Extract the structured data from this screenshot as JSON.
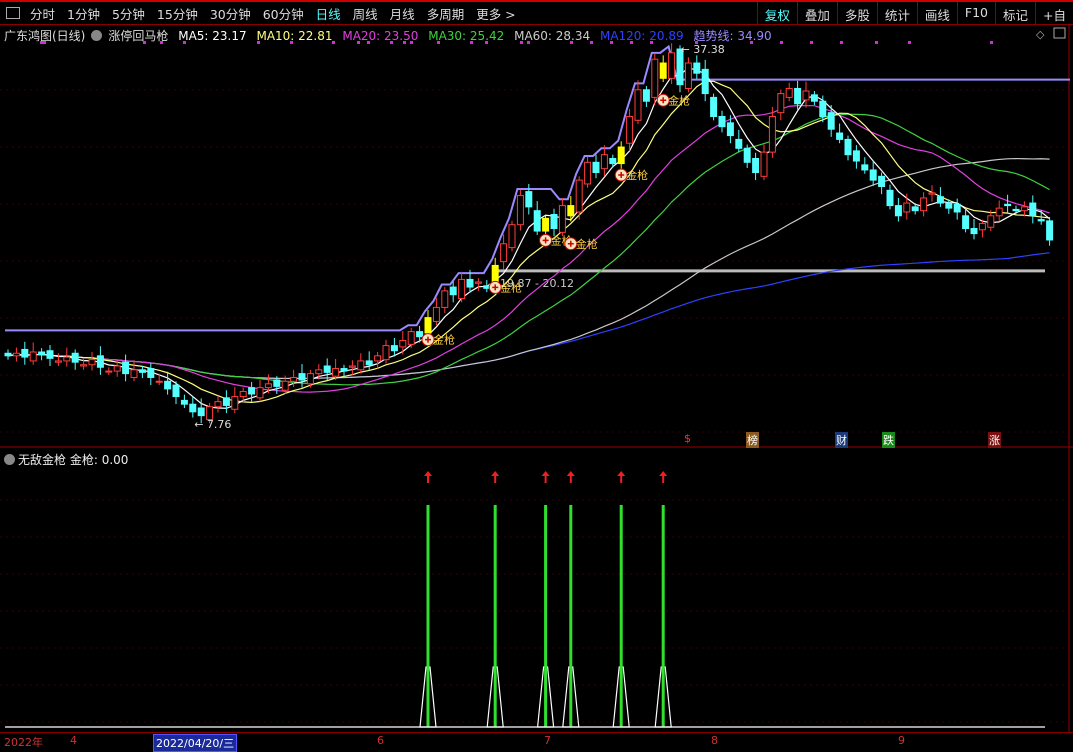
{
  "toolbar": {
    "periods": [
      "分时",
      "1分钟",
      "5分钟",
      "15分钟",
      "30分钟",
      "60分钟",
      "日线",
      "周线",
      "月线",
      "多周期",
      "更多 >"
    ],
    "active": "日线",
    "right_buttons": [
      "复权",
      "叠加",
      "多股",
      "统计",
      "画线",
      "F10",
      "标记",
      "+自"
    ]
  },
  "info": {
    "title": "广东鸿图(日线)",
    "indicator": "涨停回马枪",
    "ma5": "MA5: 23.17",
    "ma10": "MA10: 22.81",
    "ma20": "MA20: 23.50",
    "ma30": "MA30: 25.42",
    "ma60": "MA60: 28.34",
    "ma120": "MA120: 20.89",
    "trend": "趋势线: 34.90"
  },
  "colors": {
    "up": "#ff3b3b",
    "down": "#54ffff",
    "signal": "#ffff00",
    "ma5": "#ffffff",
    "ma10": "#ffff80",
    "ma20": "#e040e0",
    "ma30": "#40d040",
    "ma60": "#c8c8c8",
    "ma120": "#3040ff",
    "trend": "#9a8aff"
  },
  "annotations": {
    "high": "37.38",
    "low": "7.76",
    "range": "19.87 - 20.12",
    "signal_label": "金枪"
  },
  "events": [
    {
      "label": "$",
      "color": "#ff3030",
      "bg": "#000"
    },
    {
      "label": "榜",
      "color": "#fff",
      "bg": "#8a5a20"
    },
    {
      "label": "财",
      "color": "#fff",
      "bg": "#1a3a7a"
    },
    {
      "label": "跌",
      "color": "#fff",
      "bg": "#1a8a1a"
    },
    {
      "label": "涨",
      "color": "#fff",
      "bg": "#7a1010"
    }
  ],
  "indicator": {
    "name": "无敌金枪",
    "value": "金枪: 0.00"
  },
  "axis": {
    "labels": [
      "2022年",
      "4",
      "2022/04/20/三",
      "6",
      "7",
      "8",
      "9"
    ]
  },
  "chart_data": {
    "type": "candlestick",
    "closes": [
      13.2,
      13.4,
      13.1,
      13.5,
      13.3,
      13.0,
      12.8,
      13.1,
      12.7,
      12.5,
      12.9,
      12.3,
      12.0,
      12.4,
      11.8,
      12.1,
      11.9,
      11.5,
      11.2,
      10.6,
      10.0,
      9.4,
      8.8,
      8.5,
      9.2,
      9.6,
      9.3,
      10.0,
      10.4,
      10.2,
      10.7,
      11.0,
      10.8,
      11.2,
      11.5,
      11.3,
      11.8,
      12.1,
      11.9,
      12.2,
      12.0,
      12.4,
      12.8,
      12.5,
      13.2,
      14.0,
      13.6,
      14.4,
      15.1,
      14.7,
      16.2,
      17.0,
      18.3,
      18.0,
      19.2,
      18.6,
      19.0,
      18.5,
      20.3,
      22.0,
      23.5,
      25.8,
      24.9,
      23.0,
      24.0,
      23.2,
      25.0,
      24.2,
      27.0,
      28.4,
      27.6,
      29.0,
      28.3,
      29.6,
      32.0,
      34.1,
      33.2,
      36.5,
      35.0,
      37.0,
      34.5,
      36.2,
      35.4,
      33.8,
      32.0,
      31.2,
      30.5,
      29.5,
      28.4,
      27.6,
      29.2,
      32.0,
      33.8,
      34.2,
      33.0,
      34.0,
      33.2,
      32.0,
      31.0,
      30.2,
      29.0,
      28.5,
      27.8,
      27.0,
      26.5,
      25.0,
      24.2,
      25.2,
      24.6,
      25.6,
      26.0,
      25.2,
      24.8,
      24.5,
      23.2,
      22.8,
      23.6,
      24.2,
      24.8,
      25.0,
      24.6,
      24.9,
      24.2,
      23.8,
      22.3
    ],
    "signal_days": [
      50,
      58,
      64,
      67,
      73,
      78
    ],
    "high": 37.38,
    "low": 7.76,
    "support": 19.87,
    "trend_level": 34.9,
    "ylim": [
      7.0,
      38.0
    ]
  }
}
